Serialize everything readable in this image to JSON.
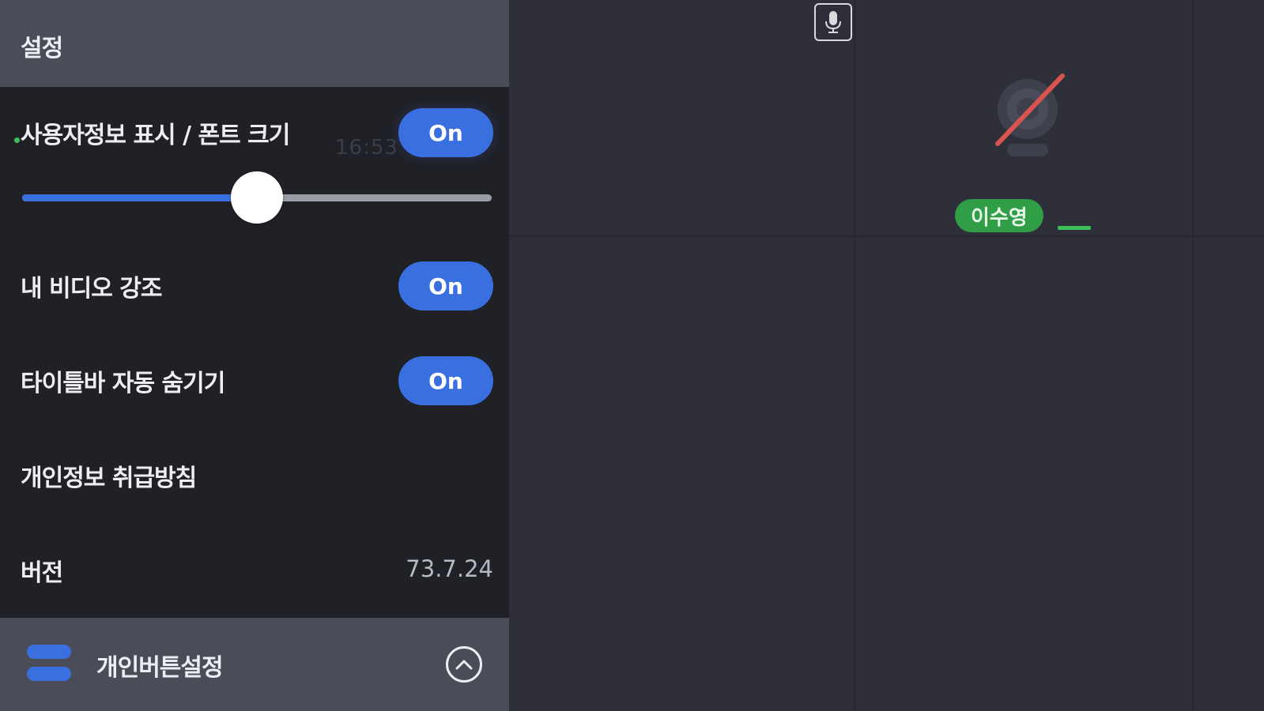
{
  "settings_panel": {
    "title": "설정",
    "items": [
      {
        "label": "사용자정보 표시 / 폰트 크기",
        "toggle": "On"
      },
      {
        "label": "내 비디오 강조",
        "toggle": "On"
      },
      {
        "label": "타이틀바 자동 숨기기",
        "toggle": "On"
      },
      {
        "label": "개인정보 취급방침"
      },
      {
        "label": "버전",
        "value": "73.7.24"
      }
    ],
    "ghost_time": "16:53",
    "font_size_slider": {
      "value": 0.5
    },
    "bottom_bar": {
      "label": "개인버튼설정",
      "icon": "menu-icon",
      "action_icon": "chevron-up-icon"
    }
  },
  "video_area": {
    "participant_name": "이수영",
    "icons": [
      "mic-icon",
      "camera-off-icon"
    ]
  },
  "colors": {
    "accent": "#3a6fe0",
    "panel_bg": "#202127",
    "header_bg": "#4a4c57",
    "video_bg": "#2e2f39",
    "name_badge": "#2f9e47",
    "camera_off_slash": "#d9534f"
  }
}
